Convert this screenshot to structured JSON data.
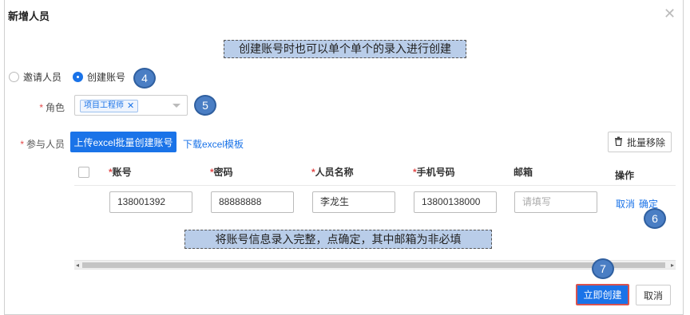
{
  "dialog": {
    "title": "新增人员",
    "close_icon": "close-icon"
  },
  "annotations": {
    "top_note": "创建账号时也可以单个单个的录入进行创建",
    "middle_note": "将账号信息录入完整，点确定，其中邮箱为非必填",
    "badges": [
      "4",
      "5",
      "6",
      "7"
    ]
  },
  "mode": {
    "options": [
      {
        "label": "邀请人员",
        "checked": false
      },
      {
        "label": "创建账号",
        "checked": true
      }
    ]
  },
  "role": {
    "label": "角色",
    "required_mark": "*",
    "selected_tag": "项目工程师",
    "tag_remove": "✕"
  },
  "participants": {
    "label": "参与人员",
    "required_mark": "*",
    "upload_button": "上传excel批量创建账号",
    "download_link": "下载excel模板",
    "bulk_remove_button": "批量移除",
    "bulk_remove_icon": "trash-icon"
  },
  "table": {
    "columns": [
      {
        "label": "账号",
        "required": "*"
      },
      {
        "label": "密码",
        "required": "*"
      },
      {
        "label": "人员名称",
        "required": "*"
      },
      {
        "label": "手机号码",
        "required": "*"
      },
      {
        "label": "邮箱",
        "required": ""
      },
      {
        "label": "操作",
        "required": ""
      }
    ],
    "row": {
      "account": "138001392",
      "password": "88888888",
      "name": "李龙生",
      "phone": "13800138000",
      "email_placeholder": "请填写",
      "action_cancel": "取消",
      "action_confirm": "确定"
    }
  },
  "footer": {
    "create_button": "立即创建",
    "cancel_button": "取消"
  },
  "colors": {
    "primary": "#1a73e8",
    "required": "#e34a4a",
    "callout_bg": "#b9cde9",
    "badge_bg": "#4a7ec4"
  }
}
